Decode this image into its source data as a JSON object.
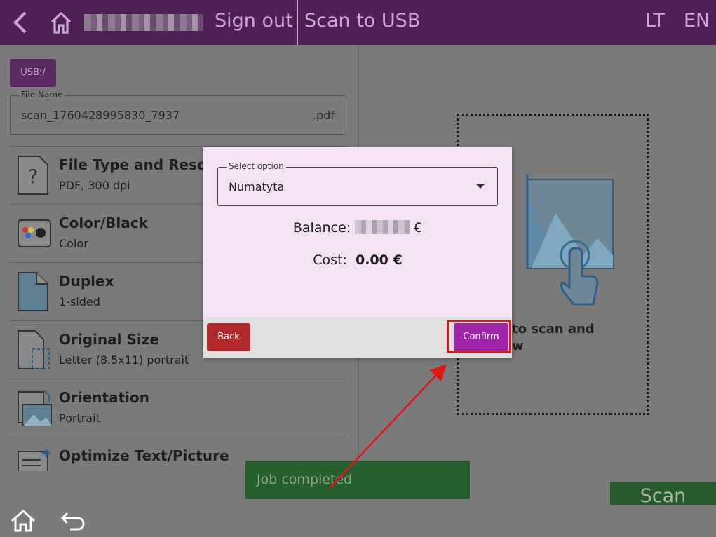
{
  "topbar": {
    "signout": "Sign out",
    "title": "Scan to USB",
    "lang1": "LT",
    "lang2": "EN"
  },
  "left": {
    "usb_button": "USB:/",
    "filename_label": "File Name",
    "filename_value": "scan_1760428995830_7937",
    "filename_ext": ".pdf",
    "settings": [
      {
        "name": "File Type and Resolution",
        "value": "PDF, 300 dpi",
        "icon": "file-type-icon"
      },
      {
        "name": "Color/Black",
        "value": "Color",
        "icon": "color-icon"
      },
      {
        "name": "Duplex",
        "value": "1-sided",
        "icon": "duplex-icon"
      },
      {
        "name": "Original Size",
        "value": "Letter (8.5x11) portrait",
        "icon": "original-size-icon"
      },
      {
        "name": "Orientation",
        "value": "Portrait",
        "icon": "orientation-icon"
      },
      {
        "name": "Optimize Text/Picture",
        "value": "",
        "icon": "optimize-icon"
      }
    ]
  },
  "preview": {
    "line1": "to scan and",
    "line2": "w"
  },
  "dialog": {
    "select_label": "Select option",
    "select_value": "Numatyta",
    "balance_label": "Balance:",
    "balance_currency": "€",
    "cost_label": "Cost:",
    "cost_value": "0.00 €",
    "back": "Back",
    "confirm": "Confirm"
  },
  "toast": "Job completed",
  "scan": "Scan",
  "colors": {
    "topbar": "#4f1f58",
    "dialog_bg": "#f5e3f5",
    "confirm": "#9e25a8",
    "back": "#b22a2a",
    "toast": "#25602c",
    "annotation": "#e01515"
  }
}
